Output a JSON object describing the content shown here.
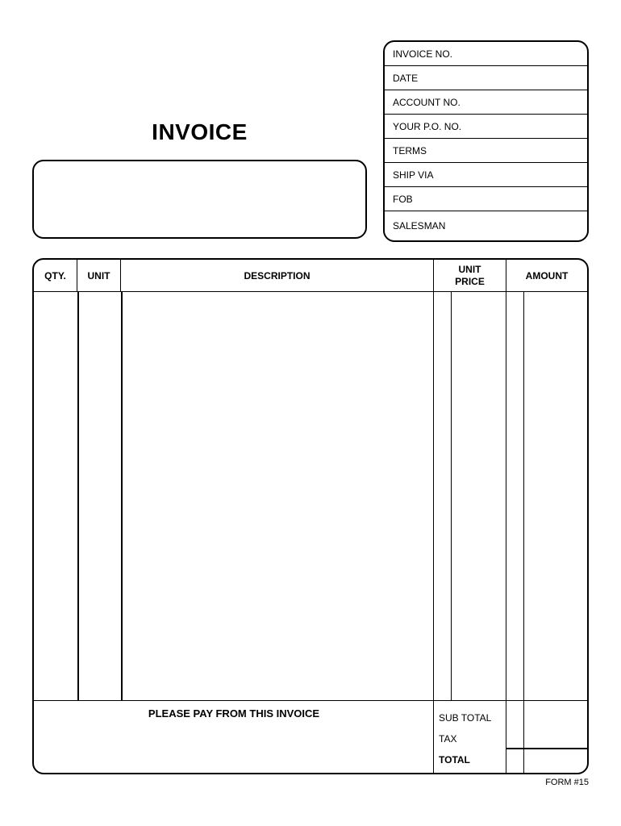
{
  "title": "INVOICE",
  "info_fields": {
    "invoice_no": "INVOICE NO.",
    "date": "DATE",
    "account_no": "ACCOUNT NO.",
    "your_po_no": "YOUR P.O. NO.",
    "terms": "TERMS",
    "ship_via": "SHIP VIA",
    "fob": "FOB",
    "salesman": "SALESMAN"
  },
  "columns": {
    "qty": "QTY.",
    "unit": "UNIT",
    "description": "DESCRIPTION",
    "unit_price_line1": "UNIT",
    "unit_price_line2": "PRICE",
    "amount": "AMOUNT"
  },
  "footer": {
    "pay_text": "PLEASE PAY FROM THIS INVOICE",
    "sub_total": "SUB TOTAL",
    "tax": "TAX",
    "total": "TOTAL"
  },
  "form_no": "FORM #15"
}
